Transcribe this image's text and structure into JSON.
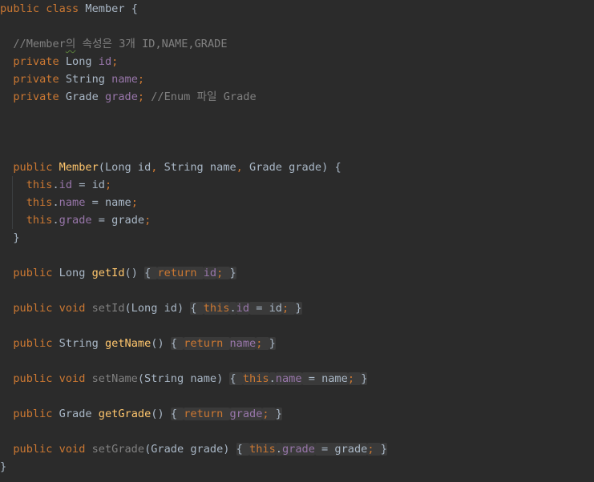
{
  "colors": {
    "background": "#2b2b2b",
    "keyword": "#cc7832",
    "field": "#9876aa",
    "method": "#ffc66d",
    "comment": "#808080",
    "text": "#a9b7c6",
    "fold_background": "#3a3a3a"
  },
  "code": {
    "lines": [
      [
        {
          "t": "public class ",
          "k": "kw"
        },
        {
          "t": "Member {",
          "k": "plain"
        }
      ],
      [],
      [
        {
          "t": "  //Member",
          "k": "comment"
        },
        {
          "t": "의",
          "k": "comment",
          "typo": true
        },
        {
          "t": " 속성은 3개 ID,NAME,GRADE",
          "k": "comment"
        }
      ],
      [
        {
          "t": "  private ",
          "k": "kw"
        },
        {
          "t": "Long ",
          "k": "plain"
        },
        {
          "t": "id",
          "k": "field"
        },
        {
          "t": ";",
          "k": "kw"
        }
      ],
      [
        {
          "t": "  private ",
          "k": "kw"
        },
        {
          "t": "String ",
          "k": "plain"
        },
        {
          "t": "name",
          "k": "field"
        },
        {
          "t": ";",
          "k": "kw"
        }
      ],
      [
        {
          "t": "  private ",
          "k": "kw"
        },
        {
          "t": "Grade ",
          "k": "plain"
        },
        {
          "t": "grade",
          "k": "field"
        },
        {
          "t": "; ",
          "k": "kw"
        },
        {
          "t": "//Enum 파일 Grade",
          "k": "comment"
        }
      ],
      [],
      [],
      [],
      [
        {
          "t": "  public ",
          "k": "kw"
        },
        {
          "t": "Member",
          "k": "method"
        },
        {
          "t": "(Long id",
          "k": "plain"
        },
        {
          "t": ", ",
          "k": "kw"
        },
        {
          "t": "String name",
          "k": "plain"
        },
        {
          "t": ", ",
          "k": "kw"
        },
        {
          "t": "Grade grade) {",
          "k": "plain"
        }
      ],
      [
        {
          "t": "    this",
          "k": "kw"
        },
        {
          "t": ".",
          "k": "plain"
        },
        {
          "t": "id",
          "k": "field"
        },
        {
          "t": " = id",
          "k": "plain"
        },
        {
          "t": ";",
          "k": "kw"
        }
      ],
      [
        {
          "t": "    this",
          "k": "kw"
        },
        {
          "t": ".",
          "k": "plain"
        },
        {
          "t": "name",
          "k": "field"
        },
        {
          "t": " = name",
          "k": "plain"
        },
        {
          "t": ";",
          "k": "kw"
        }
      ],
      [
        {
          "t": "    this",
          "k": "kw"
        },
        {
          "t": ".",
          "k": "plain"
        },
        {
          "t": "grade",
          "k": "field"
        },
        {
          "t": " = grade",
          "k": "plain"
        },
        {
          "t": ";",
          "k": "kw"
        }
      ],
      [
        {
          "t": "  }",
          "k": "plain"
        }
      ],
      [],
      [
        {
          "t": "  public ",
          "k": "kw"
        },
        {
          "t": "Long ",
          "k": "plain"
        },
        {
          "t": "getId",
          "k": "method"
        },
        {
          "t": "() ",
          "k": "plain"
        },
        {
          "t": "{ ",
          "k": "plain",
          "fold": true
        },
        {
          "t": "return ",
          "k": "kw",
          "fold": true
        },
        {
          "t": "id",
          "k": "field",
          "fold": true
        },
        {
          "t": "; ",
          "k": "kw",
          "fold": true
        },
        {
          "t": "}",
          "k": "plain",
          "fold": true
        }
      ],
      [],
      [
        {
          "t": "  public void ",
          "k": "kw"
        },
        {
          "t": "setId",
          "k": "unused"
        },
        {
          "t": "(Long id) ",
          "k": "plain"
        },
        {
          "t": "{ ",
          "k": "plain",
          "fold": true
        },
        {
          "t": "this",
          "k": "kw",
          "fold": true
        },
        {
          "t": ".",
          "k": "plain",
          "fold": true
        },
        {
          "t": "id",
          "k": "field",
          "fold": true
        },
        {
          "t": " = id",
          "k": "plain",
          "fold": true
        },
        {
          "t": "; ",
          "k": "kw",
          "fold": true
        },
        {
          "t": "}",
          "k": "plain",
          "fold": true
        }
      ],
      [],
      [
        {
          "t": "  public ",
          "k": "kw"
        },
        {
          "t": "String ",
          "k": "plain"
        },
        {
          "t": "getName",
          "k": "method"
        },
        {
          "t": "() ",
          "k": "plain"
        },
        {
          "t": "{ ",
          "k": "plain",
          "fold": true
        },
        {
          "t": "return ",
          "k": "kw",
          "fold": true
        },
        {
          "t": "name",
          "k": "field",
          "fold": true
        },
        {
          "t": "; ",
          "k": "kw",
          "fold": true
        },
        {
          "t": "}",
          "k": "plain",
          "fold": true
        }
      ],
      [],
      [
        {
          "t": "  public void ",
          "k": "kw"
        },
        {
          "t": "setName",
          "k": "unused"
        },
        {
          "t": "(String name) ",
          "k": "plain"
        },
        {
          "t": "{ ",
          "k": "plain",
          "fold": true
        },
        {
          "t": "this",
          "k": "kw",
          "fold": true
        },
        {
          "t": ".",
          "k": "plain",
          "fold": true
        },
        {
          "t": "name",
          "k": "field",
          "fold": true
        },
        {
          "t": " = name",
          "k": "plain",
          "fold": true
        },
        {
          "t": "; ",
          "k": "kw",
          "fold": true
        },
        {
          "t": "}",
          "k": "plain",
          "fold": true
        }
      ],
      [],
      [
        {
          "t": "  public ",
          "k": "kw"
        },
        {
          "t": "Grade ",
          "k": "plain"
        },
        {
          "t": "getGrade",
          "k": "method"
        },
        {
          "t": "() ",
          "k": "plain"
        },
        {
          "t": "{ ",
          "k": "plain",
          "fold": true
        },
        {
          "t": "return ",
          "k": "kw",
          "fold": true
        },
        {
          "t": "grade",
          "k": "field",
          "fold": true
        },
        {
          "t": "; ",
          "k": "kw",
          "fold": true
        },
        {
          "t": "}",
          "k": "plain",
          "fold": true
        }
      ],
      [],
      [
        {
          "t": "  public void ",
          "k": "kw"
        },
        {
          "t": "setGrade",
          "k": "unused"
        },
        {
          "t": "(Grade grade) ",
          "k": "plain"
        },
        {
          "t": "{ ",
          "k": "plain",
          "fold": true
        },
        {
          "t": "this",
          "k": "kw",
          "fold": true
        },
        {
          "t": ".",
          "k": "plain",
          "fold": true
        },
        {
          "t": "grade",
          "k": "field",
          "fold": true
        },
        {
          "t": " = grade",
          "k": "plain",
          "fold": true
        },
        {
          "t": "; ",
          "k": "kw",
          "fold": true
        },
        {
          "t": "}",
          "k": "plain",
          "fold": true
        }
      ],
      [
        {
          "t": "}",
          "k": "plain"
        }
      ]
    ]
  }
}
